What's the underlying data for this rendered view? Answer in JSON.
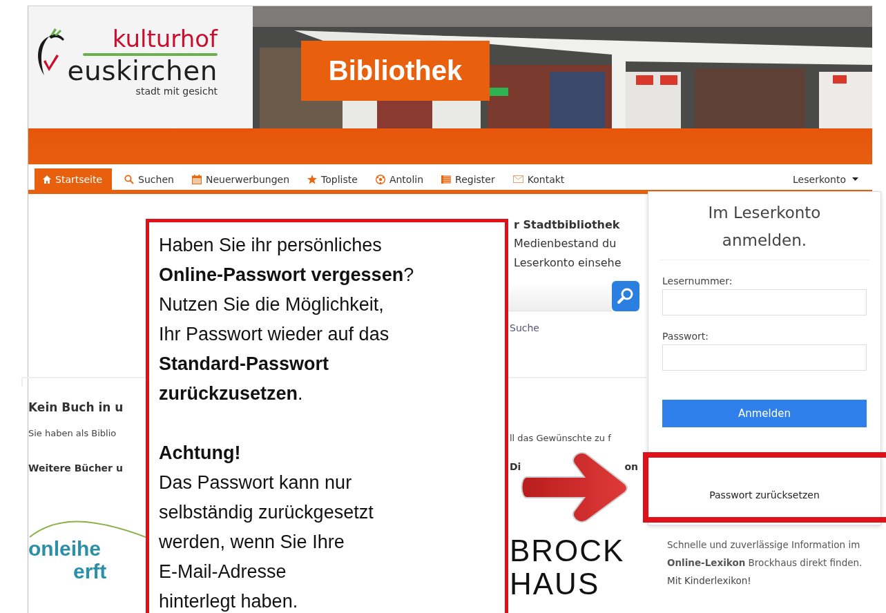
{
  "header": {
    "logo": {
      "name_top": "kulturhof",
      "name_bottom": "euskirchen",
      "tagline": "stadt mit gesicht"
    },
    "banner_label": "Bibliothek"
  },
  "nav": {
    "items": [
      {
        "label": "Startseite",
        "selected": true
      },
      {
        "label": "Suchen",
        "selected": false
      },
      {
        "label": "Neuerwerbungen",
        "selected": false
      },
      {
        "label": "Topliste",
        "selected": false
      },
      {
        "label": "Antolin",
        "selected": false
      },
      {
        "label": "Register",
        "selected": false
      },
      {
        "label": "Kontakt",
        "selected": false
      }
    ],
    "account_menu": {
      "label": "Leserkonto",
      "expanded": true
    }
  },
  "intro": {
    "heading_fragment": "r Stadtbibliothek",
    "lines": [
      "Medienbestand du",
      "Leserkonto einsehe"
    ],
    "search_link": "Suche"
  },
  "notice": {
    "heading": "Kein Buch in u",
    "text_left": "Sie haben als Biblio",
    "text_right": "ll das Gewünschte zu f"
  },
  "more_books": {
    "heading_left": "Weitere Bücher u",
    "heading_fragments": [
      "Di",
      "on"
    ]
  },
  "partners": [
    {
      "kind": "onleihe",
      "lines": [
        "onleihe",
        "erft"
      ]
    },
    {
      "kind": "brockhaus",
      "lines": [
        "BROCK",
        "HAUS"
      ]
    }
  ],
  "brockhaus_info": {
    "text": "Schnelle und zuverlässige Information im **Online-Lexikon** Brockhaus direkt finden.",
    "link": "Mit Kinderlexikon!"
  },
  "login_dropdown": {
    "title": "Im Leserkonto anmelden.",
    "fields": [
      {
        "label": "Lesernummer:"
      },
      {
        "label": "Passwort:"
      }
    ],
    "submit": "Anmelden",
    "reset_link": "Passwort zurücksetzen"
  },
  "annotation": {
    "intro": "Haben Sie ihr persönliches\n**Online-Passwort vergessen**?\nNutzen Sie die Möglichkeit,\nIhr Passwort wieder auf das\n**Standard-Passwort**\n**zurückzusetzen**.",
    "warning_heading": "Achtung!",
    "warning_text": "Das Passwort kann nur\nselbständig zurückgesetzt\nwerden, wenn Sie Ihre\nE-Mail-Adresse\nhinterlegt haben."
  }
}
